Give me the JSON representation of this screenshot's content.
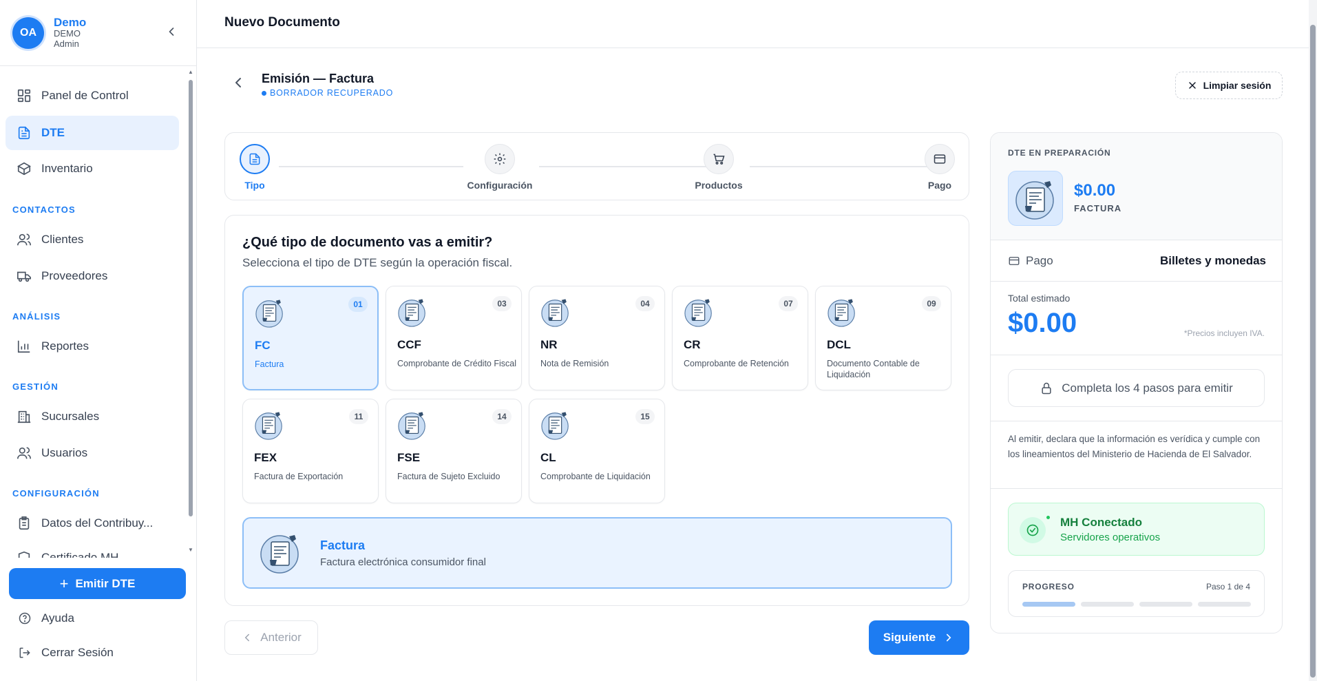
{
  "profile": {
    "initials": "OA",
    "name": "Demo",
    "company": "DEMO",
    "role": "Admin"
  },
  "nav": {
    "items": [
      {
        "label": "Panel de Control",
        "icon": "dashboard-icon"
      },
      {
        "label": "DTE",
        "icon": "document-icon",
        "active": true
      },
      {
        "label": "Inventario",
        "icon": "box-icon"
      }
    ],
    "sections": {
      "contactos": {
        "title": "CONTACTOS",
        "items": [
          {
            "label": "Clientes",
            "icon": "users-icon"
          },
          {
            "label": "Proveedores",
            "icon": "truck-icon"
          }
        ]
      },
      "analisis": {
        "title": "ANÁLISIS",
        "items": [
          {
            "label": "Reportes",
            "icon": "bar-chart-icon"
          }
        ]
      },
      "gestion": {
        "title": "GESTIÓN",
        "items": [
          {
            "label": "Sucursales",
            "icon": "building-icon"
          },
          {
            "label": "Usuarios",
            "icon": "users-icon"
          }
        ]
      },
      "configuracion": {
        "title": "CONFIGURACIÓN",
        "items": [
          {
            "label": "Datos del Contribuy...",
            "icon": "clipboard-icon"
          },
          {
            "label": "Certificado MH",
            "icon": "shield-icon"
          }
        ]
      }
    }
  },
  "sidebar_actions": {
    "emit_label": "Emitir DTE",
    "help_label": "Ayuda",
    "logout_label": "Cerrar Sesión"
  },
  "header": {
    "title": "Nuevo Documento"
  },
  "subheader": {
    "title": "Emisión — Factura",
    "status": "BORRADOR RECUPERADO",
    "clear_label": "Limpiar sesión"
  },
  "stepper": {
    "steps": [
      {
        "label": "Tipo",
        "icon": "document-icon",
        "active": true
      },
      {
        "label": "Configuración",
        "icon": "gear-icon"
      },
      {
        "label": "Productos",
        "icon": "cart-icon"
      },
      {
        "label": "Pago",
        "icon": "credit-card-icon"
      }
    ]
  },
  "main": {
    "question": "¿Qué tipo de documento vas a emitir?",
    "subtitle": "Selecciona el tipo de DTE según la operación fiscal.",
    "doc_types": [
      {
        "code": "01",
        "abbr": "FC",
        "name": "Factura",
        "selected": true
      },
      {
        "code": "03",
        "abbr": "CCF",
        "name": "Comprobante de Crédito Fiscal"
      },
      {
        "code": "04",
        "abbr": "NR",
        "name": "Nota de Remisión"
      },
      {
        "code": "07",
        "abbr": "CR",
        "name": "Comprobante de Retención"
      },
      {
        "code": "09",
        "abbr": "DCL",
        "name": "Documento Contable de Liquidación"
      },
      {
        "code": "11",
        "abbr": "FEX",
        "name": "Factura de Exportación"
      },
      {
        "code": "14",
        "abbr": "FSE",
        "name": "Factura de Sujeto Excluido"
      },
      {
        "code": "15",
        "abbr": "CL",
        "name": "Comprobante de Liquidación"
      }
    ],
    "selection": {
      "title": "Factura",
      "description": "Factura electrónica consumidor final"
    },
    "prev_label": "Anterior",
    "next_label": "Siguiente"
  },
  "panel": {
    "label": "DTE EN PREPARACIÓN",
    "amount": "$0.00",
    "type": "FACTURA",
    "payment_label": "Pago",
    "payment_value": "Billetes y monedas",
    "total_label": "Total estimado",
    "total": "$0.00",
    "iva_note": "*Precios incluyen IVA.",
    "locked_label": "Completa los 4 pasos para emitir",
    "disclaimer": "Al emitir, declara que la información es verídica y cumple con los lineamientos del Ministerio de Hacienda de El Salvador.",
    "mh_title": "MH Conectado",
    "mh_sub": "Servidores operativos",
    "progress_label": "PROGRESO",
    "progress_step": "Paso 1 de 4",
    "progress_completed": 1,
    "progress_total": 4
  },
  "colors": {
    "accent": "#1d7cf2",
    "success": "#16a34a",
    "selected_bg": "#eaf3ff"
  }
}
